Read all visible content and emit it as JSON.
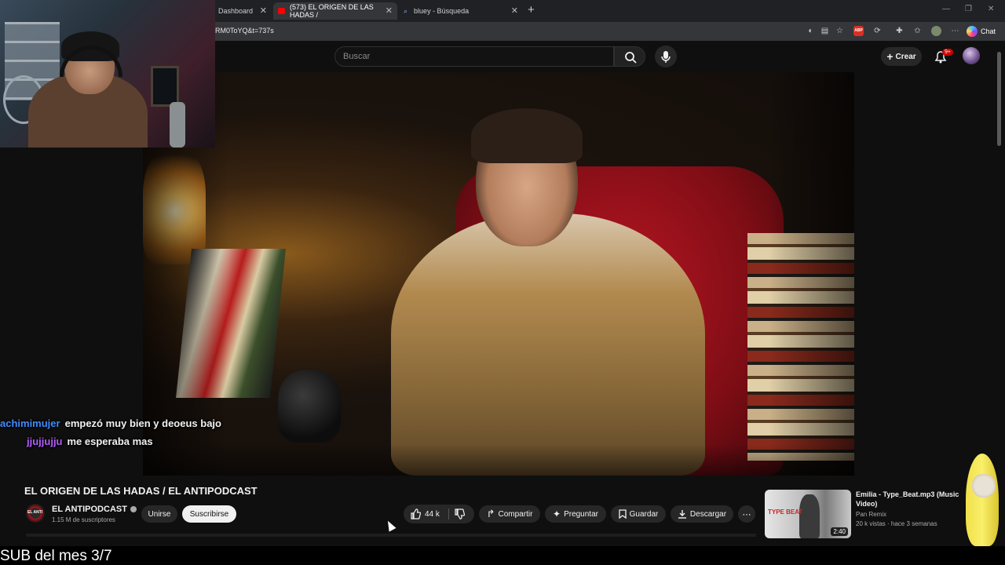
{
  "browser": {
    "tabs": [
      {
        "title": "Dashboard",
        "active": false
      },
      {
        "title": "(573) EL ORIGEN DE LAS HADAS /",
        "active": true
      },
      {
        "title": "bluey - Búsqueda",
        "active": false
      }
    ],
    "url_fragment": "RM0ToYQ&t=737s",
    "chat_label": "Chat",
    "ext_abp": "ABP"
  },
  "youtube": {
    "search_placeholder": "Buscar",
    "create_label": "Crear",
    "notif_badge": "9+",
    "video_title": "EL ORIGEN DE LAS HADAS / EL ANTIPODCAST",
    "channel_name": "EL ANTIPODCAST",
    "channel_avatar_text": "EL ANTI",
    "subscribers": "1.15 M de suscriptores",
    "join_label": "Unirse",
    "subscribe_label": "Suscribirse",
    "likes": "44 k",
    "share_label": "Compartir",
    "ask_label": "Preguntar",
    "save_label": "Guardar",
    "download_label": "Descargar"
  },
  "related": {
    "title": "Emilia - Type_Beat.mp3 (Music Video)",
    "channel": "Pan Remix",
    "meta": "20 k vistas · hace 3 semanas",
    "duration": "2:40",
    "thumb_text": "TYPE BEAT"
  },
  "stream_chat": [
    {
      "user": "achimimujer",
      "message": "empezó muy bien y deoeus bajo",
      "color": "#3f8cff"
    },
    {
      "user": "jjujjujju",
      "message": "me esperaba mas",
      "color": "#b45cff"
    }
  ],
  "overlay_text": "SUB del mes 3/7",
  "colors": {
    "youtube_bg": "#0f0f0f",
    "button_bg": "#272727",
    "notif_red": "#cc0000",
    "chair_red": "#b81622"
  },
  "icons": [
    "search-icon",
    "mic-icon",
    "plus-icon",
    "bell-icon",
    "like-icon",
    "dislike-icon",
    "share-icon",
    "sparkle-icon",
    "bookmark-icon",
    "download-icon",
    "more-icon",
    "verified-icon"
  ]
}
